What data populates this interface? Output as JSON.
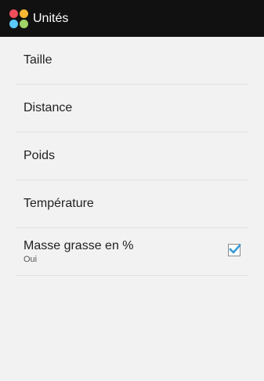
{
  "actionbar": {
    "title": "Unités",
    "icon": "app-launcher-icon",
    "icon_colors": [
      "#ef4d5a",
      "#f7b733",
      "#5ac8fa",
      "#a0d468"
    ]
  },
  "settings": {
    "items": [
      {
        "label": "Taille"
      },
      {
        "label": "Distance"
      },
      {
        "label": "Poids"
      },
      {
        "label": "Température"
      }
    ],
    "checkbox_item": {
      "label": "Masse grasse en %",
      "summary": "Oui",
      "checked": true,
      "check_color": "#3a9ad9"
    }
  }
}
